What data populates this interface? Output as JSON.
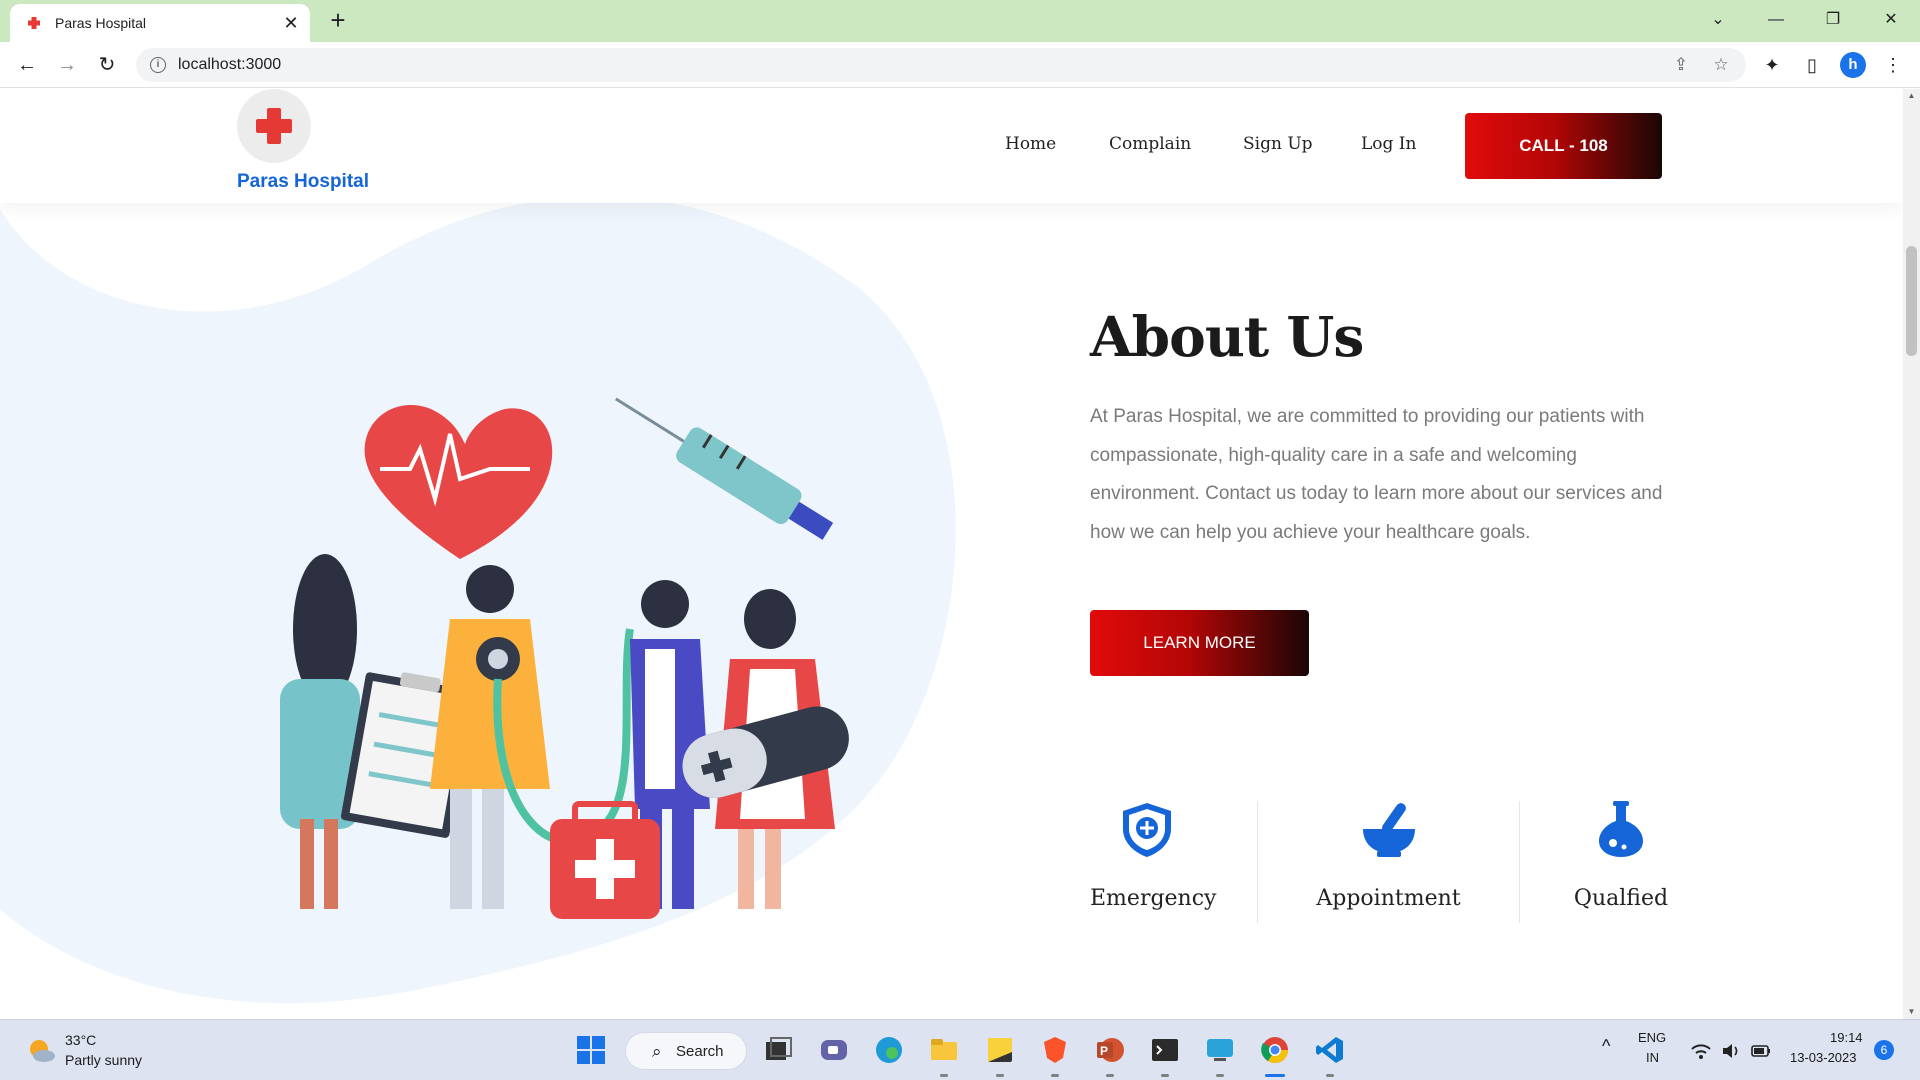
{
  "browser": {
    "tab_title": "Paras Hospital",
    "tab_close": "✕",
    "new_tab": "+",
    "url": "localhost:3000",
    "profile_initial": "h",
    "window_controls": {
      "dropdown": "⌄",
      "minimize": "—",
      "restore": "❐",
      "close": "✕"
    },
    "nav": {
      "back": "←",
      "forward": "→",
      "reload": "↻"
    },
    "toolbar": {
      "share": "⇪",
      "bookmark": "☆",
      "extensions": "✦",
      "sidepanel": "▯",
      "menu": "⋮"
    }
  },
  "site": {
    "brand": "Paras Hospital",
    "nav": [
      "Home",
      "Complain",
      "Sign Up",
      "Log In"
    ],
    "call_button": "CALL - 108",
    "about": {
      "title": "About Us",
      "text": "At Paras Hospital, we are committed to providing our patients with compassionate, high-quality care in a safe and welcoming environment. Contact us today to learn more about our services and how we can help you achieve your healthcare goals.",
      "cta": "LEARN MORE"
    },
    "features": [
      {
        "label": "Emergency",
        "icon": "shield-plus-icon"
      },
      {
        "label": "Appointment",
        "icon": "mortar-pestle-icon"
      },
      {
        "label": "Qualfied",
        "icon": "flask-icon"
      }
    ],
    "accent_color": "#1565d8",
    "cta_gradient": [
      "#e10b0b",
      "#1a0606"
    ]
  },
  "taskbar": {
    "weather_temp": "33°C",
    "weather_desc": "Partly sunny",
    "search_label": "Search",
    "lang_top": "ENG",
    "lang_bottom": "IN",
    "time": "19:14",
    "date": "13-03-2023",
    "notifications": "6",
    "tray_chevron": "^"
  }
}
